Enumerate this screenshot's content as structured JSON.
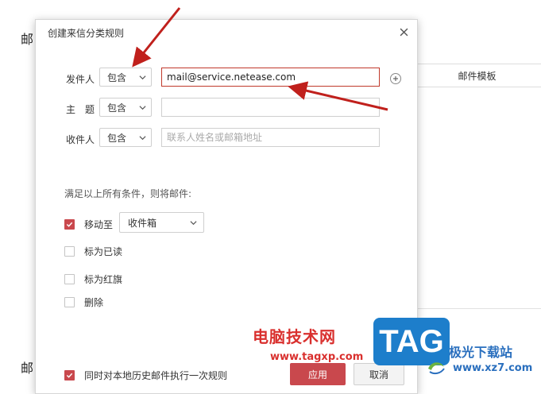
{
  "background": {
    "heading_top": "邮",
    "heading_bottom": "邮",
    "table_header": "邮件模板"
  },
  "dialog": {
    "title": "创建来信分类规则",
    "rows": [
      {
        "label": "发件人",
        "operator": "包含",
        "value": "mail@service.netease.com",
        "placeholder": ""
      },
      {
        "label": "主　题",
        "operator": "包含",
        "value": "",
        "placeholder": ""
      },
      {
        "label": "收件人",
        "operator": "包含",
        "value": "",
        "placeholder": "联系人姓名或邮箱地址"
      }
    ],
    "condition_text": "满足以上所有条件，则将邮件:",
    "actions": [
      {
        "label": "移动至",
        "checked": true
      },
      {
        "label": "标为已读",
        "checked": false
      },
      {
        "label": "标为红旗",
        "checked": false
      },
      {
        "label": "删除",
        "checked": false
      }
    ],
    "move_target": "收件箱",
    "history_label": "同时对本地历史邮件执行一次规则",
    "history_checked": true,
    "apply_label": "应用",
    "cancel_label": "取消"
  },
  "watermark": {
    "site_cn": "电脑技术网",
    "site_url": "www.tagxp.com",
    "tag": "TAG",
    "right_cn": "极光下载站",
    "right_url": "www.xz7.com"
  },
  "colors": {
    "accent": "#c9484d",
    "annotation_arrow": "#c0201c"
  },
  "icons": {
    "close": "close-icon",
    "dropdown": "chevron-down-icon",
    "add": "plus-circle-icon",
    "check": "checkmark-icon"
  }
}
